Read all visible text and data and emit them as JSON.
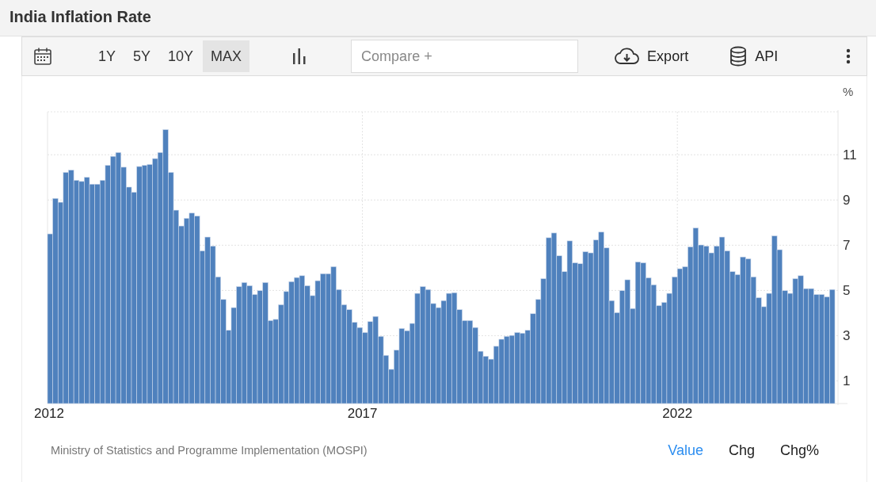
{
  "title": "India Inflation Rate",
  "toolbar": {
    "ranges": [
      {
        "label": "1Y",
        "selected": false
      },
      {
        "label": "5Y",
        "selected": false
      },
      {
        "label": "10Y",
        "selected": false
      },
      {
        "label": "MAX",
        "selected": true
      }
    ],
    "compare": {
      "placeholder": "Compare +"
    },
    "actions": [
      {
        "kind": "export",
        "label": "Export"
      },
      {
        "kind": "api",
        "label": "API"
      }
    ]
  },
  "chart": {
    "chart_data": {
      "type": "bar",
      "ylabel": "%",
      "ylim": [
        0,
        12.9
      ],
      "yticks": [
        1,
        3,
        5,
        7,
        9,
        11
      ],
      "xlim": [
        2012,
        2024.5
      ],
      "xticks": [
        2012,
        2017,
        2022
      ],
      "grid": true,
      "x": [
        2012,
        2012.083,
        2012.167,
        2012.25,
        2012.333,
        2012.417,
        2012.5,
        2012.583,
        2012.667,
        2012.75,
        2012.833,
        2012.917,
        2013,
        2013.083,
        2013.167,
        2013.25,
        2013.333,
        2013.417,
        2013.5,
        2013.583,
        2013.667,
        2013.75,
        2013.833,
        2013.917,
        2014,
        2014.083,
        2014.167,
        2014.25,
        2014.333,
        2014.417,
        2014.5,
        2014.583,
        2014.667,
        2014.75,
        2014.833,
        2014.917,
        2015,
        2015.083,
        2015.167,
        2015.25,
        2015.333,
        2015.417,
        2015.5,
        2015.583,
        2015.667,
        2015.75,
        2015.833,
        2015.917,
        2016,
        2016.083,
        2016.167,
        2016.25,
        2016.333,
        2016.417,
        2016.5,
        2016.583,
        2016.667,
        2016.75,
        2016.833,
        2016.917,
        2017,
        2017.083,
        2017.167,
        2017.25,
        2017.333,
        2017.417,
        2017.5,
        2017.583,
        2017.667,
        2017.75,
        2017.833,
        2017.917,
        2018,
        2018.083,
        2018.167,
        2018.25,
        2018.333,
        2018.417,
        2018.5,
        2018.583,
        2018.667,
        2018.75,
        2018.833,
        2018.917,
        2019,
        2019.083,
        2019.167,
        2019.25,
        2019.333,
        2019.417,
        2019.5,
        2019.583,
        2019.667,
        2019.75,
        2019.833,
        2019.917,
        2020,
        2020.083,
        2020.167,
        2020.25,
        2020.333,
        2020.417,
        2020.5,
        2020.583,
        2020.667,
        2020.75,
        2020.833,
        2020.917,
        2021,
        2021.083,
        2021.167,
        2021.25,
        2021.333,
        2021.417,
        2021.5,
        2021.583,
        2021.667,
        2021.75,
        2021.833,
        2021.917,
        2022,
        2022.083,
        2022.167,
        2022.25,
        2022.333,
        2022.417,
        2022.5,
        2022.583,
        2022.667,
        2022.75,
        2022.833,
        2022.917,
        2023,
        2023.083,
        2023.167,
        2023.25,
        2023.333,
        2023.417,
        2023.5,
        2023.583,
        2023.667,
        2023.75,
        2023.833,
        2023.917,
        2024,
        2024.083,
        2024.167,
        2024.25,
        2024.333,
        2024.417
      ],
      "series": [
        {
          "color": "#4f81bd",
          "values": [
            7.5,
            9.07,
            8.9,
            10.22,
            10.32,
            9.87,
            9.82,
            10.0,
            9.7,
            9.7,
            9.87,
            10.53,
            10.93,
            11.1,
            10.45,
            9.57,
            9.34,
            10.48,
            10.53,
            10.57,
            10.83,
            11.1,
            12.11,
            10.22,
            8.55,
            7.85,
            8.19,
            8.42,
            8.29,
            6.75,
            7.36,
            6.96,
            5.6,
            4.6,
            3.24,
            4.24,
            5.17,
            5.35,
            5.21,
            4.82,
            4.99,
            5.35,
            3.67,
            3.72,
            4.37,
            4.95,
            5.39,
            5.57,
            5.65,
            5.21,
            4.77,
            5.43,
            5.74,
            5.74,
            6.05,
            5.04,
            4.37,
            4.15,
            3.59,
            3.36,
            3.14,
            3.62,
            3.85,
            2.97,
            2.13,
            1.51,
            2.36,
            3.32,
            3.22,
            3.54,
            4.87,
            5.17,
            5.04,
            4.42,
            4.24,
            4.55,
            4.87,
            4.9,
            4.15,
            3.67,
            3.67,
            3.36,
            2.31,
            2.09,
            1.96,
            2.53,
            2.84,
            2.97,
            3.01,
            3.14,
            3.11,
            3.24,
            3.97,
            4.6,
            5.52,
            7.33,
            7.54,
            6.53,
            5.83,
            7.19,
            6.22,
            6.18,
            6.71,
            6.66,
            7.23,
            7.58,
            6.88,
            4.55,
            4.02,
            4.99,
            5.47,
            4.2,
            6.26,
            6.22,
            5.56,
            5.25,
            4.33,
            4.47,
            4.87,
            5.6,
            5.96,
            6.05,
            6.93,
            7.76,
            7.01,
            6.96,
            6.66,
            6.96,
            7.36,
            6.75,
            5.83,
            5.7,
            6.48,
            6.4,
            5.6,
            4.68,
            4.28,
            4.87,
            7.41,
            6.8,
            4.99,
            4.87,
            5.52,
            5.65,
            5.08,
            5.08,
            4.82,
            4.82,
            4.72,
            5.04
          ]
        }
      ]
    }
  },
  "footer": {
    "source": "Ministry of Statistics and Programme Implementation (MOSPI)",
    "modes": [
      {
        "label": "Value",
        "selected": true
      },
      {
        "label": "Chg",
        "selected": false
      },
      {
        "label": "Chg%",
        "selected": false
      }
    ]
  }
}
